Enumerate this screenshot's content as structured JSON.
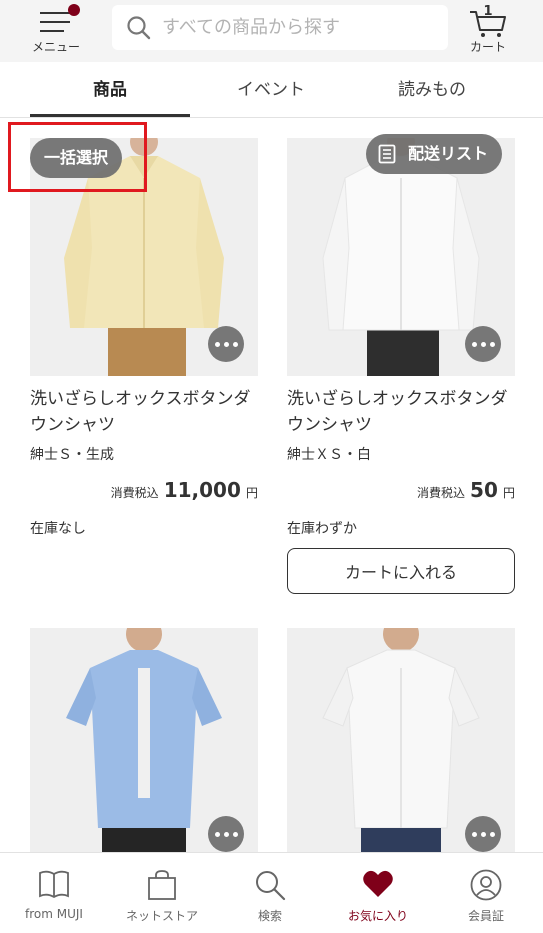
{
  "header": {
    "menu_label": "メニュー",
    "search_placeholder": "すべての商品から探す",
    "cart_count": "1",
    "cart_label": "カート",
    "icons": {
      "menu": "menu-icon",
      "search": "search-icon",
      "cart": "cart-icon"
    },
    "badge_color": "#7f0019"
  },
  "tabs": [
    {
      "label": "商品",
      "active": true
    },
    {
      "label": "イベント",
      "active": false
    },
    {
      "label": "読みもの",
      "active": false
    }
  ],
  "toolbar": {
    "bulk_select_label": "一括選択",
    "delivery_list_label": "配送リスト"
  },
  "products": [
    {
      "title": "洗いざらしオックスボタンダウンシャツ",
      "variant": "紳士Ｓ・生成",
      "price_prefix": "消費税込",
      "price": "11,000",
      "price_unit": "円",
      "stock": "在庫なし",
      "shirt_color": "#f2e6b8"
    },
    {
      "title": "洗いざらしオックスボタンダウンシャツ",
      "variant": "紳士ＸＳ・白",
      "price_prefix": "消費税込",
      "price": "50",
      "price_unit": "円",
      "stock": "在庫わずか",
      "button_label": "カートに入れる",
      "shirt_color": "#fafafa"
    },
    {
      "shirt_color": "#9bbbe6"
    },
    {
      "shirt_color": "#f8f8f8"
    }
  ],
  "bottom_nav": [
    {
      "label": "from MUJI",
      "icon": "book-icon",
      "active": false
    },
    {
      "label": "ネットストア",
      "icon": "shopping-bag-icon",
      "active": false
    },
    {
      "label": "検索",
      "icon": "search-icon",
      "active": false
    },
    {
      "label": "お気に入り",
      "icon": "heart-icon",
      "active": true
    },
    {
      "label": "会員証",
      "icon": "member-icon",
      "active": false
    }
  ],
  "accent_color": "#7f0019",
  "highlight_color": "#e0191f"
}
